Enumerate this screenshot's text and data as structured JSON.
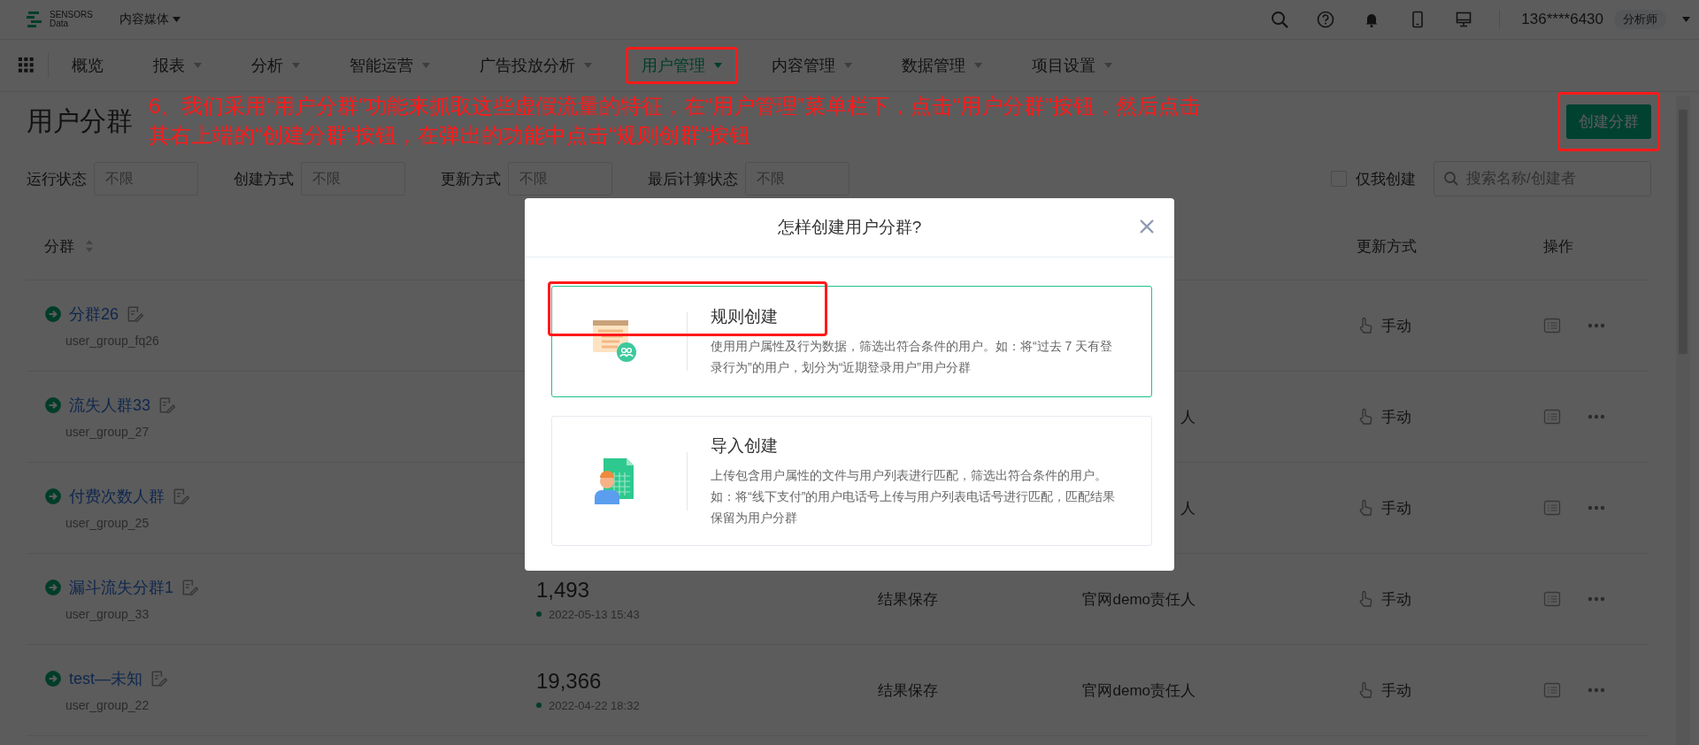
{
  "topbar": {
    "logo_lines": [
      "SENSORS",
      "Data"
    ],
    "project": "内容媒体",
    "user": "136****6430",
    "role": "分析师"
  },
  "nav": [
    {
      "label": "概览",
      "selected": false,
      "has_menu": false,
      "highlighted": false
    },
    {
      "label": "报表",
      "selected": false,
      "has_menu": true,
      "highlighted": false
    },
    {
      "label": "分析",
      "selected": false,
      "has_menu": true,
      "highlighted": false
    },
    {
      "label": "智能运营",
      "selected": false,
      "has_menu": true,
      "highlighted": false
    },
    {
      "label": "广告投放分析",
      "selected": false,
      "has_menu": true,
      "highlighted": false
    },
    {
      "label": "用户管理",
      "selected": true,
      "has_menu": true,
      "highlighted": true
    },
    {
      "label": "内容管理",
      "selected": false,
      "has_menu": true,
      "highlighted": false
    },
    {
      "label": "数据管理",
      "selected": false,
      "has_menu": true,
      "highlighted": false
    },
    {
      "label": "项目设置",
      "selected": false,
      "has_menu": true,
      "highlighted": false
    }
  ],
  "page": {
    "title": "用户分群",
    "create_button": {
      "label": "创建分群",
      "highlighted": true
    }
  },
  "annotation": [
    "6、我们采用“用户分群”功能来抓取这些虚假流量的特征，在“用户管理”菜单栏下，点击“用户分群”按钮，然后点击",
    "其右上端的“创建分群”按钮，在弹出的功能中点击“规则创群”按钮"
  ],
  "filters": [
    {
      "label": "运行状态",
      "placeholder": "不限"
    },
    {
      "label": "创建方式",
      "placeholder": "不限"
    },
    {
      "label": "更新方式",
      "placeholder": "不限"
    },
    {
      "label": "最后计算状态",
      "placeholder": "不限"
    }
  ],
  "only_mine": {
    "label": "仅我创建",
    "checked": false
  },
  "search": {
    "placeholder": "搜索名称/创建者"
  },
  "table": {
    "columns": [
      {
        "kind": "name",
        "label": "分群",
        "sortable": true
      },
      {
        "kind": "update",
        "label": "更新方式",
        "sortable": false
      },
      {
        "kind": "actions",
        "label": "操作",
        "sortable": false
      }
    ],
    "rows": [
      {
        "name": "分群26",
        "code": "user_group_fq26",
        "update": "手动"
      },
      {
        "name": "流失人群33",
        "code": "user_group_27",
        "owner": "人",
        "update": "手动"
      },
      {
        "name": "付费次数人群",
        "code": "user_group_25",
        "owner": "人",
        "update": "手动"
      },
      {
        "name": "漏斗流失分群1",
        "code": "user_group_33",
        "count": "1,493",
        "time": "2022-05-13 15:43",
        "save": "结果保存",
        "owner": "官网demo责任人",
        "update": "手动"
      },
      {
        "name": "test—未知",
        "code": "user_group_22",
        "count": "19,366",
        "time": "2022-04-22 18:32",
        "save": "结果保存",
        "owner": "官网demo责任人",
        "update": "手动"
      }
    ]
  },
  "modal": {
    "title": "怎样创建用户分群?",
    "options": [
      {
        "kind": "rule",
        "title": "规则创建",
        "description": "使用用户属性及行为数据，筛选出符合条件的用户。如：将“过去 7 天有登录行为”的用户，划分为“近期登录用户”用户分群",
        "selected": true,
        "highlighted": true
      },
      {
        "kind": "import",
        "title": "导入创建",
        "description": "上传包含用户属性的文件与用户列表进行匹配，筛选出符合条件的用户。如：将“线下支付”的用户电话号上传与用户列表电话号进行匹配，匹配结果保留为用户分群",
        "selected": false,
        "highlighted": false
      }
    ]
  }
}
